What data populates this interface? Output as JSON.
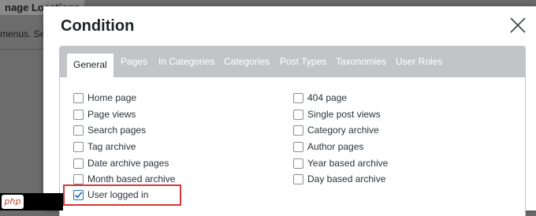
{
  "background": {
    "title": "nage Locations",
    "subtitle": "menus. Sel"
  },
  "watermark": {
    "text": "php"
  },
  "modal": {
    "title": "Condition",
    "close_icon": "close-icon"
  },
  "tabs": [
    {
      "label": "General",
      "active": true
    },
    {
      "label": "Pages",
      "active": false
    },
    {
      "label": "In Categories",
      "active": false
    },
    {
      "label": "Categories",
      "active": false
    },
    {
      "label": "Post Types",
      "active": false
    },
    {
      "label": "Taxonomies",
      "active": false
    },
    {
      "label": "User Roles",
      "active": false
    }
  ],
  "left_options": [
    {
      "label": "Home page",
      "checked": false
    },
    {
      "label": "Page views",
      "checked": false
    },
    {
      "label": "Search pages",
      "checked": false
    },
    {
      "label": "Tag archive",
      "checked": false
    },
    {
      "label": "Date archive pages",
      "checked": false
    },
    {
      "label": "Month based archive",
      "checked": false
    },
    {
      "label": "User logged in",
      "checked": true
    }
  ],
  "right_options": [
    {
      "label": "404 page",
      "checked": false
    },
    {
      "label": "Single post views",
      "checked": false
    },
    {
      "label": "Category archive",
      "checked": false
    },
    {
      "label": "Author pages",
      "checked": false
    },
    {
      "label": "Year based archive",
      "checked": false
    },
    {
      "label": "Day based archive",
      "checked": false
    }
  ],
  "colors": {
    "highlight": "#d63638",
    "checkbox_accent": "#2271b1",
    "tab_bar": "#c3c4c7"
  }
}
